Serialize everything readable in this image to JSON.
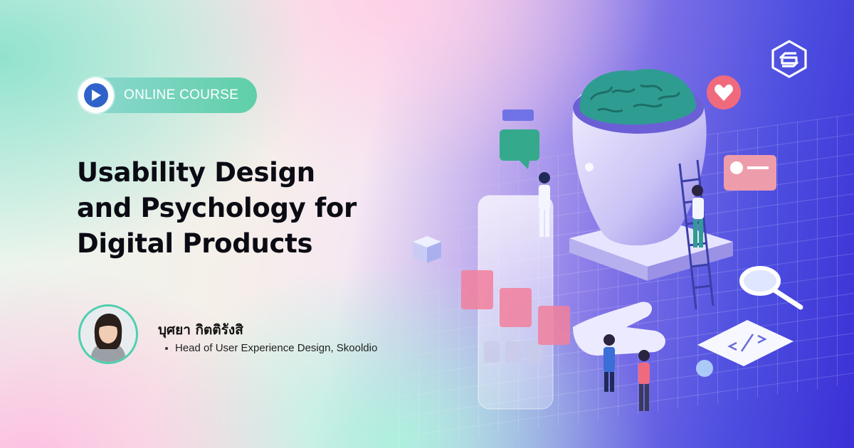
{
  "badge": {
    "label": "ONLINE COURSE",
    "icon": "play-icon"
  },
  "course": {
    "title_lines": [
      "Usability Design",
      "and Psychology for",
      "Digital Products"
    ]
  },
  "instructor": {
    "name": "บุศยา กิตติรังสิ",
    "role": "Head of User Experience Design, Skooldio"
  },
  "brand": {
    "logo": "skooldio-logo"
  },
  "colors": {
    "accent_green": "#5fcfa8",
    "play_blue": "#2f63c9",
    "title": "#0b0b14"
  }
}
